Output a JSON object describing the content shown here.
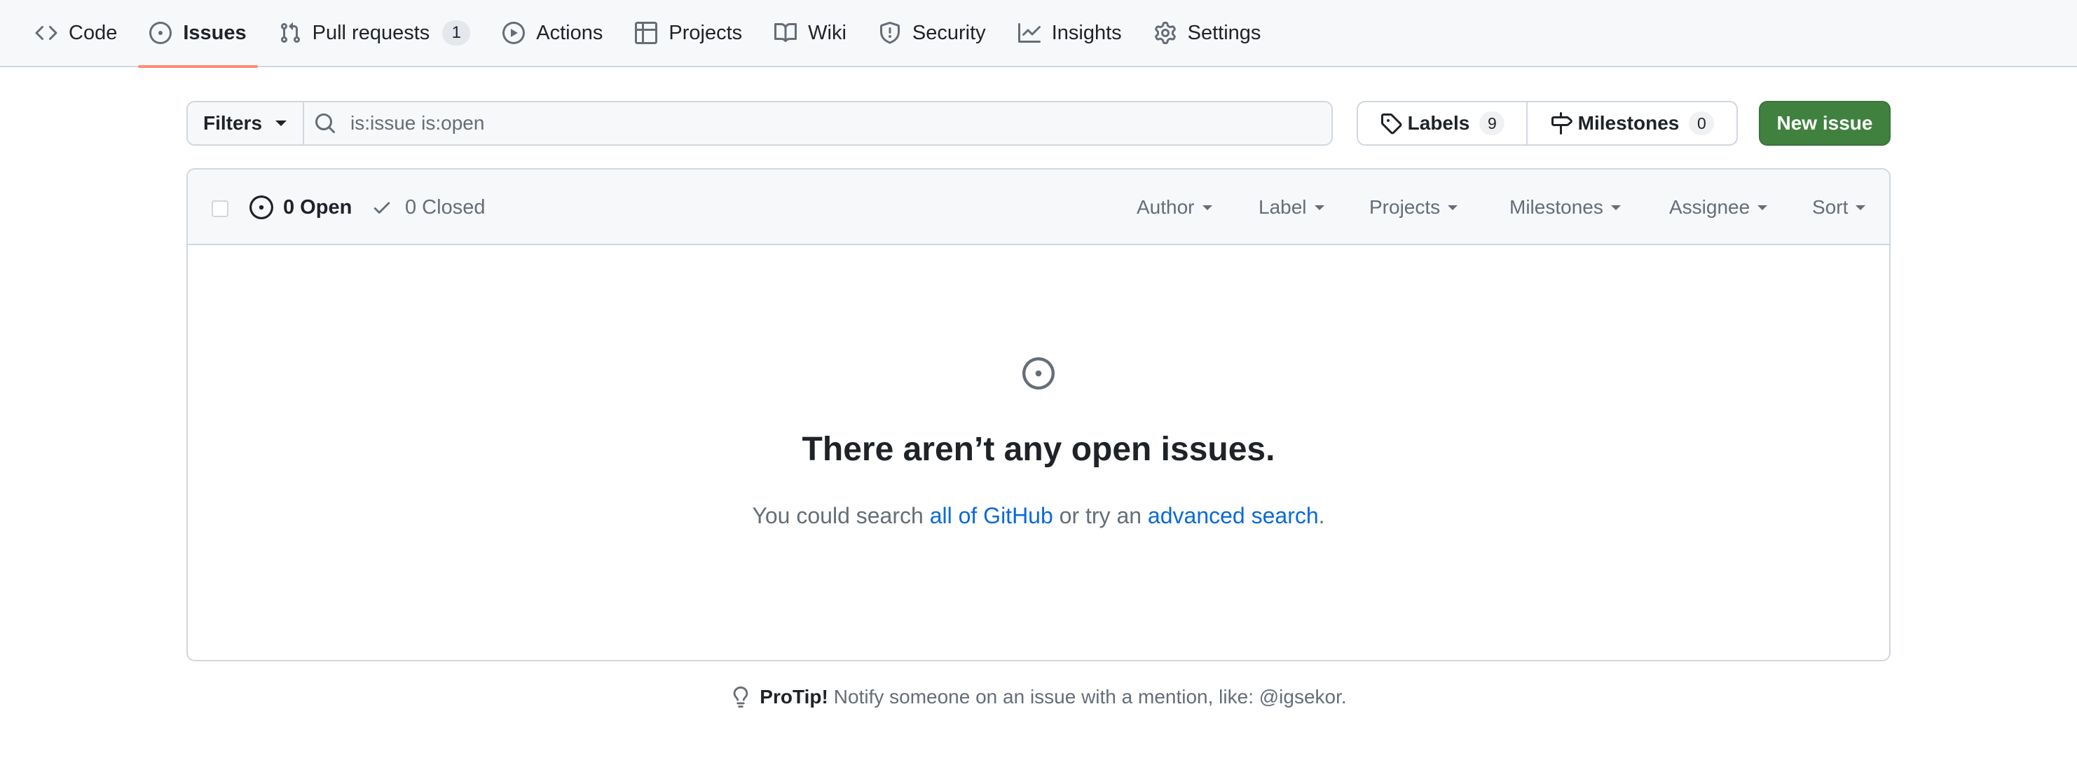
{
  "nav": {
    "items": [
      {
        "label": "Code",
        "icon": "code-icon"
      },
      {
        "label": "Issues",
        "icon": "issue-opened-icon",
        "selected": true
      },
      {
        "label": "Pull requests",
        "icon": "git-pull-request-icon",
        "count": "1"
      },
      {
        "label": "Actions",
        "icon": "play-icon"
      },
      {
        "label": "Projects",
        "icon": "table-icon"
      },
      {
        "label": "Wiki",
        "icon": "book-icon"
      },
      {
        "label": "Security",
        "icon": "shield-icon"
      },
      {
        "label": "Insights",
        "icon": "graph-icon"
      },
      {
        "label": "Settings",
        "icon": "gear-icon"
      }
    ]
  },
  "subnav": {
    "filters_label": "Filters",
    "search_value": "is:issue is:open",
    "labels_label": "Labels",
    "labels_count": "9",
    "milestones_label": "Milestones",
    "milestones_count": "0",
    "new_issue_label": "New issue"
  },
  "issues_header": {
    "open_label": "0 Open",
    "closed_label": "0 Closed",
    "filters": [
      "Author",
      "Label",
      "Projects",
      "Milestones",
      "Assignee",
      "Sort"
    ]
  },
  "blankslate": {
    "title": "There aren’t any open issues.",
    "text_before": "You could search ",
    "link_all": "all of GitHub",
    "text_middle": " or try an ",
    "link_advanced": "advanced search",
    "text_after": "."
  },
  "protip": {
    "label": "ProTip!",
    "text": "Notify someone on an issue with a mention, like: @igsekor."
  },
  "colors": {
    "accent_underline": "#fd8c73",
    "new_issue_bg": "#408140",
    "link": "#0969da"
  }
}
